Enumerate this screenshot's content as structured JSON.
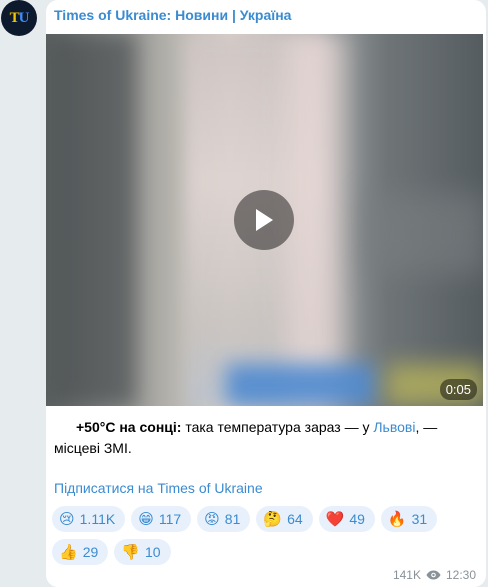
{
  "channel": {
    "avatar_t": "T",
    "avatar_u": "U",
    "name": "Times of Ukraine: Новини | Україна"
  },
  "video": {
    "duration": "0:05"
  },
  "caption": {
    "bold": "+50°C на сонці:",
    "text1": " така температура зараз — у ",
    "link": "Львові",
    "text2": ", — місцеві ЗМІ."
  },
  "subscribe_link": "Підписатися на Times of Ukraine",
  "reactions": [
    {
      "emoji": "😢",
      "icon": "crying-face-icon",
      "count": "1.11K"
    },
    {
      "emoji": "😁",
      "icon": "grinning-face-icon",
      "count": "117"
    },
    {
      "emoji": "😡",
      "icon": "angry-face-icon",
      "count": "81"
    },
    {
      "emoji": "🤔",
      "icon": "thinking-face-icon",
      "count": "64"
    },
    {
      "emoji": "❤️",
      "icon": "red-heart-icon",
      "count": "49"
    },
    {
      "emoji": "🔥",
      "icon": "fire-icon",
      "count": "31"
    },
    {
      "emoji": "👍",
      "icon": "thumbs-up-icon",
      "count": "29"
    },
    {
      "emoji": "👎",
      "icon": "thumbs-down-icon",
      "count": "10"
    }
  ],
  "meta": {
    "views": "141K",
    "time": "12:30"
  },
  "colors": {
    "accent": "#3a8bd1",
    "reaction_bg": "#e8f1fb",
    "background": "#e6ebee"
  }
}
